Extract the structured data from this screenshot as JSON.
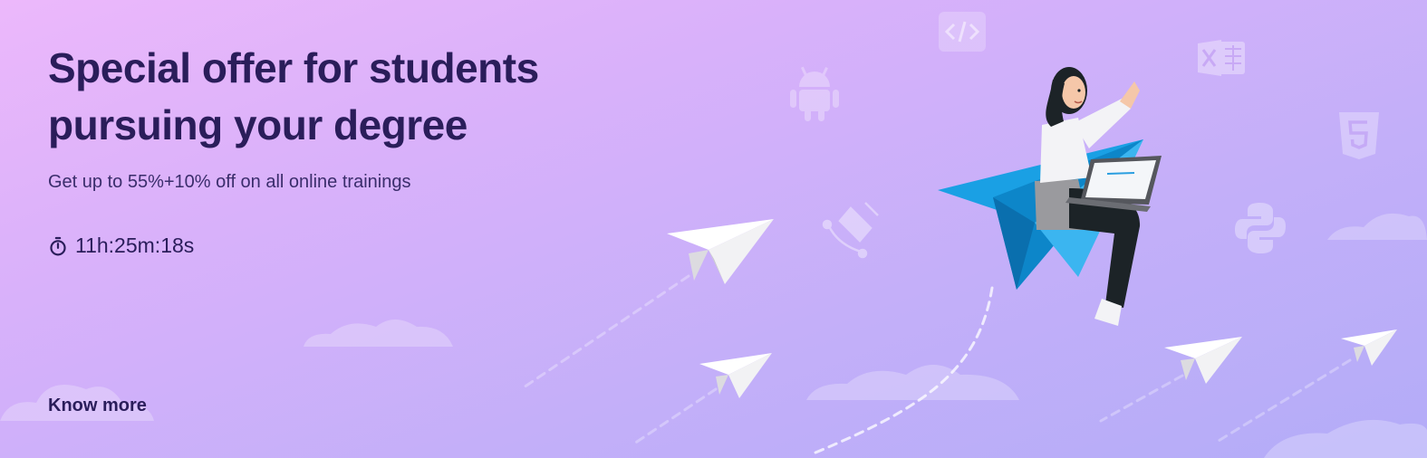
{
  "banner": {
    "headline": "Special offer for students pursuing your degree",
    "subtitle": "Get up to 55%+10% off on all online trainings",
    "timer": "11h:25m:18s",
    "cta_label": "Know more",
    "icons": [
      "stopwatch-icon",
      "code-icon",
      "android-icon",
      "excel-icon",
      "html5-icon",
      "python-icon",
      "pen-tool-icon"
    ]
  },
  "colors": {
    "headline": "#2a1d5a",
    "background_start": "#ecb8fb",
    "background_end": "#b3acf8",
    "plane_blue": "#1aa0e4"
  }
}
